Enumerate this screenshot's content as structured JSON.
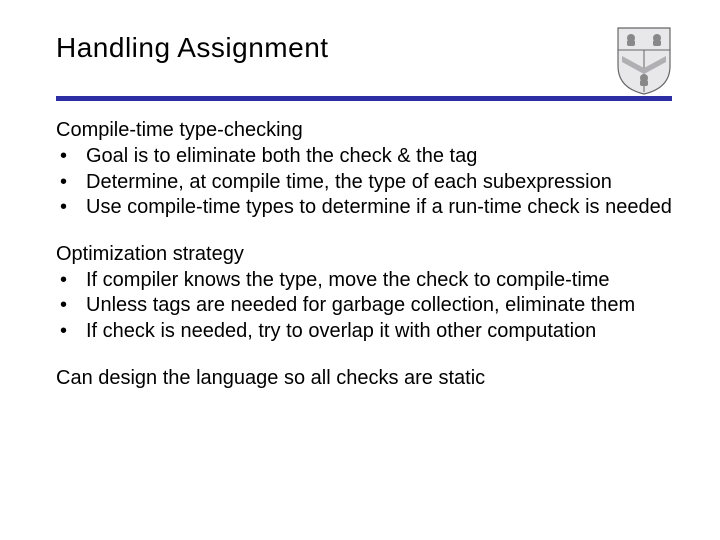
{
  "title": "Handling Assignment",
  "section1": {
    "heading": "Compile-time type-checking",
    "bullets": [
      "Goal is to eliminate both the check & the tag",
      "Determine, at compile time, the type of each subexpression",
      "Use compile-time types to determine if a run-time check is needed"
    ]
  },
  "section2": {
    "heading": "Optimization strategy",
    "bullets": [
      "If compiler knows the type, move the check to compile-time",
      "Unless tags are needed for garbage collection, eliminate them",
      "If check is needed, try to overlap it with other computation"
    ]
  },
  "closing": "Can design the language so all checks are static"
}
